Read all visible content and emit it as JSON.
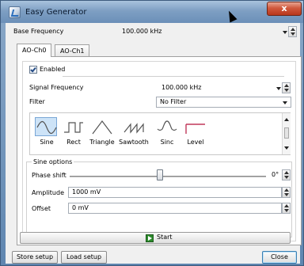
{
  "window": {
    "title": "Easy Generator",
    "close_glyph": "x"
  },
  "base_frequency": {
    "label": "Base Frequency",
    "value": "100.000 kHz"
  },
  "tabs": [
    {
      "label": "AO-Ch0"
    },
    {
      "label": "AO-Ch1"
    }
  ],
  "channel": {
    "enabled_label": "Enabled",
    "signal_frequency": {
      "label": "Signal Frequency",
      "value": "100.000 kHz"
    },
    "filter": {
      "label": "Filter",
      "value": "No Filter"
    },
    "waveforms": [
      {
        "label": "Sine",
        "icon": "sine-wave-icon",
        "selected": true
      },
      {
        "label": "Rect",
        "icon": "rect-wave-icon"
      },
      {
        "label": "Triangle",
        "icon": "triangle-wave-icon"
      },
      {
        "label": "Sawtooth",
        "icon": "sawtooth-wave-icon"
      },
      {
        "label": "Sinc",
        "icon": "sinc-wave-icon"
      },
      {
        "label": "Level",
        "icon": "level-wave-icon"
      }
    ],
    "sine_options": {
      "title": "Sine options",
      "phase_shift": {
        "label": "Phase shift",
        "value": "0°",
        "fraction": 0.46
      },
      "amplitude": {
        "label": "Amplitude",
        "value": "1000 mV"
      },
      "offset": {
        "label": "Offset",
        "value": "0 mV"
      }
    }
  },
  "start_label": "Start",
  "buttons": {
    "store": "Store setup",
    "load": "Load setup",
    "close": "Close"
  },
  "colors": {
    "title_bar": "#7e9fc3",
    "selected_wave": "#cde3f7",
    "close_red": "#c94a2e",
    "start_green": "#2e8c2e"
  }
}
